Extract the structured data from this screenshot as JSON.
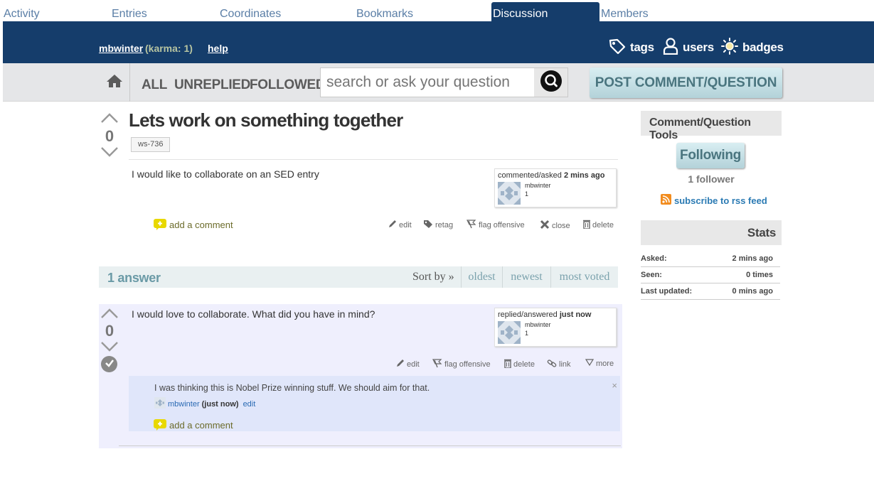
{
  "tabs": [
    {
      "label": "Activity"
    },
    {
      "label": "Entries"
    },
    {
      "label": "Coordinates"
    },
    {
      "label": "Bookmarks"
    },
    {
      "label": "Discussion",
      "active": true
    },
    {
      "label": "Members"
    }
  ],
  "header": {
    "username": "mbwinter",
    "karma": "(karma: 1)",
    "help": "help",
    "nav": {
      "tags": "tags",
      "users": "users",
      "badges": "badges"
    }
  },
  "searchbar": {
    "scopes": {
      "all": "ALL",
      "unreplied": "UNREPLIED",
      "followed": "FOLLOWED"
    },
    "placeholder": "search or ask your question",
    "post_button": "POST COMMENT/QUESTION"
  },
  "question": {
    "votes": "0",
    "title": "Lets work on something together",
    "tag": "ws-736",
    "body": "I would like to collaborate on an SED entry",
    "userbox": {
      "action": "commented/asked",
      "when": "2 mins ago",
      "user": "mbwinter",
      "rep": "1"
    },
    "add_comment": "add a comment",
    "actions": {
      "edit": "edit",
      "retag": "retag",
      "flag": "flag offensive",
      "close": "close",
      "delete": "delete"
    }
  },
  "answers_header": {
    "count": "1 answer",
    "sort_by": "Sort by »",
    "sort_options": {
      "oldest": "oldest",
      "newest": "newest",
      "most_voted": "most voted"
    }
  },
  "answer": {
    "votes": "0",
    "body": "I would love to collaborate. What did you have in mind?",
    "userbox": {
      "action": "replied/answered",
      "when": "just now",
      "user": "mbwinter",
      "rep": "1"
    },
    "actions": {
      "edit": "edit",
      "flag": "flag offensive",
      "delete": "delete",
      "link": "link",
      "more": "more"
    },
    "comment": {
      "text": "I was thinking this is Nobel Prize winning stuff. We should aim for that.",
      "user": "mbwinter",
      "when": "(just now)",
      "edit": "edit",
      "close": "×"
    },
    "add_comment": "add a comment"
  },
  "sidebar": {
    "tools_title": "Comment/Question Tools",
    "following_button": "Following",
    "follower_count": "1 follower",
    "rss": "subscribe to rss feed",
    "stats_title": "Stats",
    "stats": [
      {
        "key": "Asked:",
        "value": "2 mins ago"
      },
      {
        "key": "Seen:",
        "value": "0 times"
      },
      {
        "key": "Last updated:",
        "value": "0 mins ago"
      }
    ]
  },
  "colors": {
    "header_bg": "#153d6b",
    "tab_text": "#5a7ea6",
    "button_text": "#4a757f",
    "answer_bg": "#efeffd",
    "comment_bg": "#e0e6fa"
  }
}
